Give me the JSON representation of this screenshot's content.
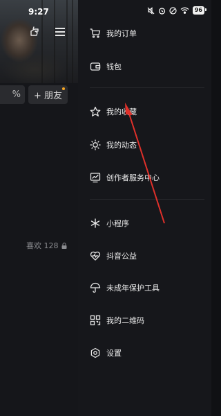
{
  "status_bar": {
    "time": "9:27",
    "battery": "96"
  },
  "profile_background": {
    "percent_chip": "%",
    "add_friend_label": "+ 朋友",
    "likes_label": "喜欢 128"
  },
  "drawer": {
    "items": [
      {
        "label": "我的订单",
        "icon": "cart-icon"
      },
      {
        "label": "钱包",
        "icon": "wallet-icon"
      },
      {
        "label": "我的收藏",
        "icon": "star-icon"
      },
      {
        "label": "我的动态",
        "icon": "sun-icon"
      },
      {
        "label": "创作者服务中心",
        "icon": "chart-icon"
      },
      {
        "label": "小程序",
        "icon": "asterisk-icon"
      },
      {
        "label": "抖音公益",
        "icon": "heart-icon"
      },
      {
        "label": "未成年保护工具",
        "icon": "umbrella-icon"
      },
      {
        "label": "我的二维码",
        "icon": "qrcode-icon"
      },
      {
        "label": "设置",
        "icon": "gear-icon"
      }
    ]
  },
  "colors": {
    "drawer_bg": "#16171b",
    "annotation_arrow": "#e0302a"
  }
}
